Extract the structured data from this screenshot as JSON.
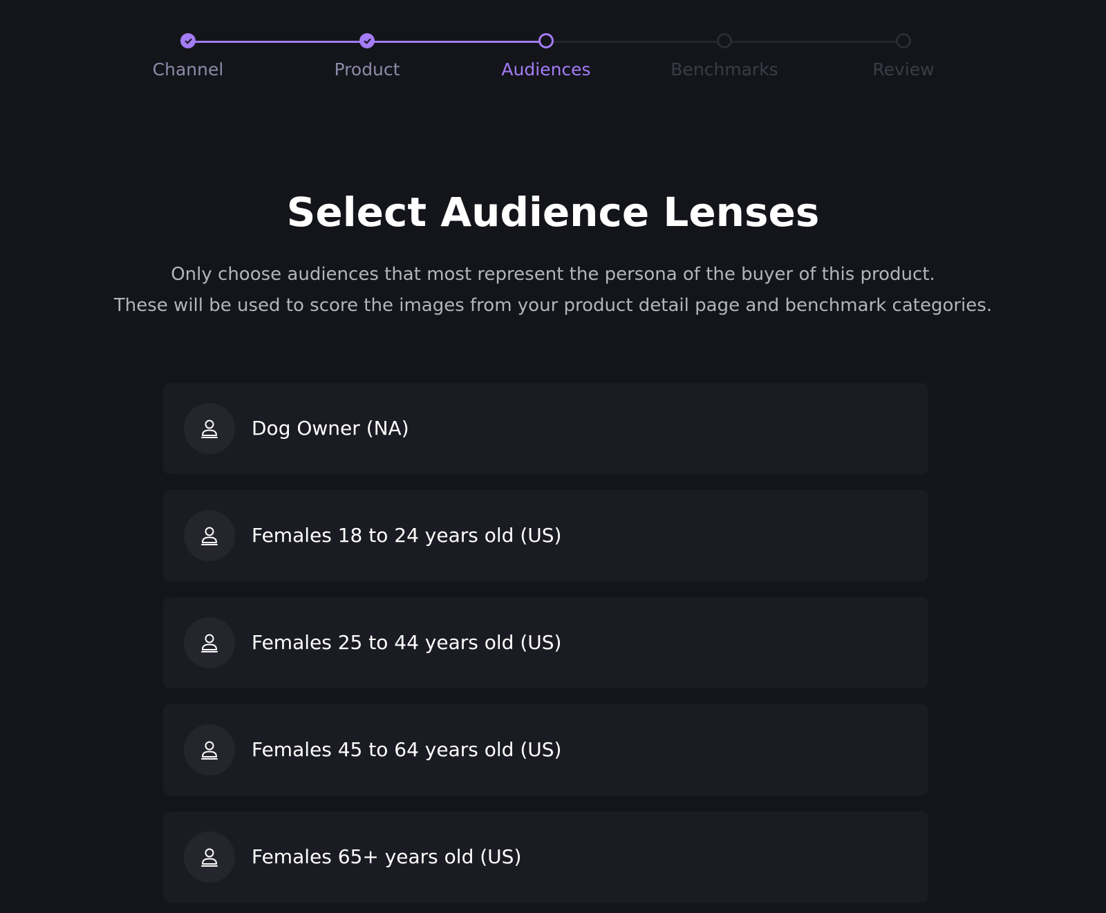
{
  "stepper": {
    "steps": [
      {
        "label": "Channel",
        "state": "done"
      },
      {
        "label": "Product",
        "state": "done"
      },
      {
        "label": "Audiences",
        "state": "active"
      },
      {
        "label": "Benchmarks",
        "state": "todo"
      },
      {
        "label": "Review",
        "state": "todo"
      }
    ]
  },
  "header": {
    "title": "Select Audience Lenses",
    "subtitle_line1": "Only choose audiences that most represent the persona of the buyer of this product.",
    "subtitle_line2": "These will be used to score the images from your product detail page and benchmark categories."
  },
  "audiences": [
    {
      "label": "Dog Owner (NA)",
      "icon": "user-icon"
    },
    {
      "label": "Females 18 to 24 years old (US)",
      "icon": "user-icon"
    },
    {
      "label": "Females 25 to 44 years old (US)",
      "icon": "user-icon"
    },
    {
      "label": "Females 45 to 64 years old (US)",
      "icon": "user-icon"
    },
    {
      "label": "Females 65+ years old (US)",
      "icon": "user-icon"
    }
  ],
  "colors": {
    "background": "#14151b",
    "accent": "#a47cf5",
    "card": "#1b1c23",
    "inactive_step": "#2a2b33"
  }
}
